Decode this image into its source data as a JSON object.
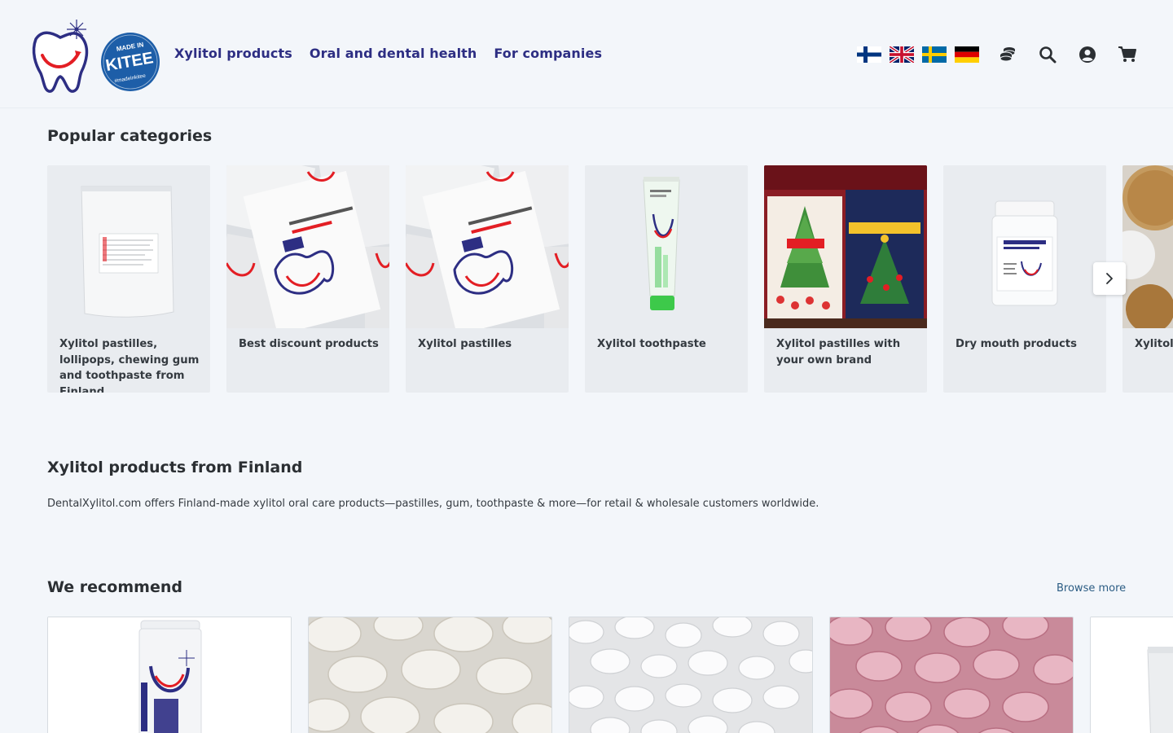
{
  "header": {
    "nav": [
      {
        "label": "Xylitol products"
      },
      {
        "label": "Oral and dental health"
      },
      {
        "label": "For companies"
      }
    ],
    "logo_kitee": {
      "line1": "MADE IN",
      "line2": "KITEE",
      "line3": "#madeinkitee"
    },
    "languages": [
      "fi",
      "en",
      "sv",
      "de"
    ],
    "icons": [
      "coins-icon",
      "search-icon",
      "user-circle-icon",
      "cart-icon"
    ]
  },
  "popular": {
    "title": "Popular categories",
    "items": [
      {
        "label": "Xylitol pastilles, lollipops, chewing gum and toothpaste from Finland"
      },
      {
        "label": "Best discount products"
      },
      {
        "label": "Xylitol pastilles"
      },
      {
        "label": "Xylitol toothpaste"
      },
      {
        "label": "Xylitol pastilles with your own brand"
      },
      {
        "label": "Dry mouth products"
      },
      {
        "label": "Xylitol"
      }
    ]
  },
  "about": {
    "title": "Xylitol products from Finland",
    "text": "DentalXylitol.com offers Finland-made xylitol oral care products—pastilles, gum, toothpaste & more—for retail & wholesale customers worldwide."
  },
  "recommend": {
    "title": "We recommend",
    "browse_label": "Browse more"
  },
  "colors": {
    "brand": "#2d2e83",
    "accent_red": "#e31e24",
    "background": "#f3f6fa"
  }
}
